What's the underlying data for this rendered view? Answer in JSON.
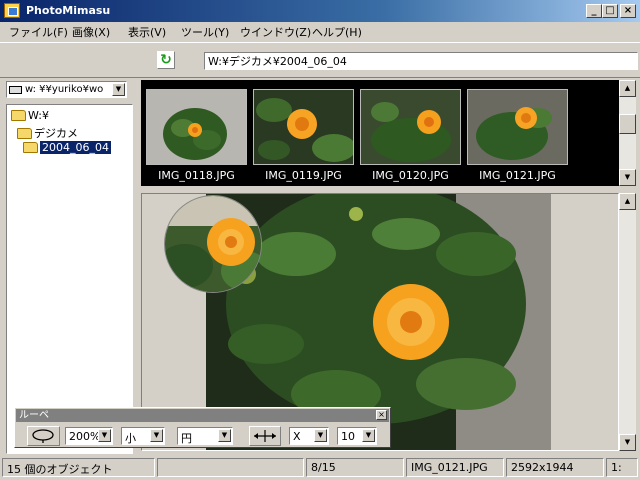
{
  "window": {
    "title": "PhotoMimasu"
  },
  "menu": [
    "ファイル(F)",
    "画像(X)",
    "表示(V)",
    "ツール(Y)",
    "ウインドウ(Z)",
    "ヘルプ(H)"
  ],
  "toolbar": {
    "path": "W:¥デジカメ¥2004_06_04"
  },
  "drive": {
    "label": "w: ¥¥yuriko¥wo"
  },
  "tree": [
    {
      "label": "W:¥",
      "level": 0,
      "selected": false
    },
    {
      "label": "デジカメ",
      "level": 1,
      "selected": false
    },
    {
      "label": "2004_06_04",
      "level": 2,
      "selected": true
    }
  ],
  "thumbnails": [
    {
      "name": "IMG_0118.JPG"
    },
    {
      "name": "IMG_0119.JPG"
    },
    {
      "name": "IMG_0120.JPG"
    },
    {
      "name": "IMG_0121.JPG"
    }
  ],
  "loupe": {
    "title": "ルーペ",
    "zoom": "200%",
    "size": "小",
    "shape": "円",
    "axis": "X",
    "step": "10"
  },
  "status": {
    "objects": "15 個のオブジェクト",
    "empty": "",
    "position": "8/15",
    "filename": "IMG_0121.JPG",
    "dimensions": "2592x1944",
    "extra": "1:"
  },
  "colors": {
    "titlebar": "#0a246a",
    "selection": "#0a246a",
    "thumb_bg": "#000000"
  }
}
